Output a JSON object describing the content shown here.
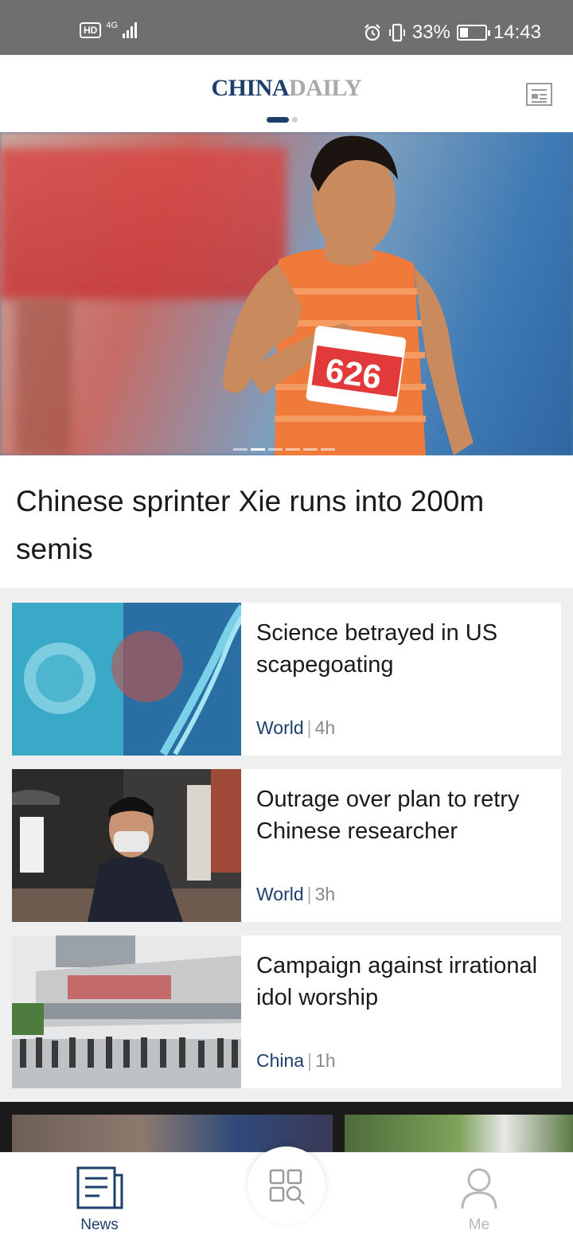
{
  "status_bar": {
    "hd_badge": "HD",
    "network": "4G",
    "battery_percent": "33%",
    "battery_level": 0.33,
    "time": "14:43",
    "icons": [
      "alarm-icon",
      "vibrate-icon",
      "battery-icon",
      "signal-icon"
    ]
  },
  "header": {
    "logo_part1": "CHINA",
    "logo_part2": "DAILY",
    "page_index": 1,
    "page_count": 2
  },
  "hero": {
    "title": "Chinese sprinter Xie runs into 200m semis",
    "bib_number": "626",
    "slide_count": 6,
    "active_slide": 2
  },
  "feed": {
    "articles": [
      {
        "title": "Science betrayed in US scapegoating",
        "category": "World",
        "time": "4h"
      },
      {
        "title": "Outrage over plan to retry Chinese researcher",
        "category": "World",
        "time": "3h"
      },
      {
        "title": "Campaign against irrational idol worship",
        "category": "China",
        "time": "1h"
      }
    ]
  },
  "bottom_nav": {
    "news_label": "News",
    "me_label": "Me",
    "icons": [
      "news-icon",
      "categories-search-icon",
      "profile-icon"
    ]
  },
  "colors": {
    "brand_navy": "#1c3f6b",
    "brand_gray": "#a9a9a9",
    "status_bar": "#6f6f6f",
    "feed_bg": "#efefef"
  }
}
